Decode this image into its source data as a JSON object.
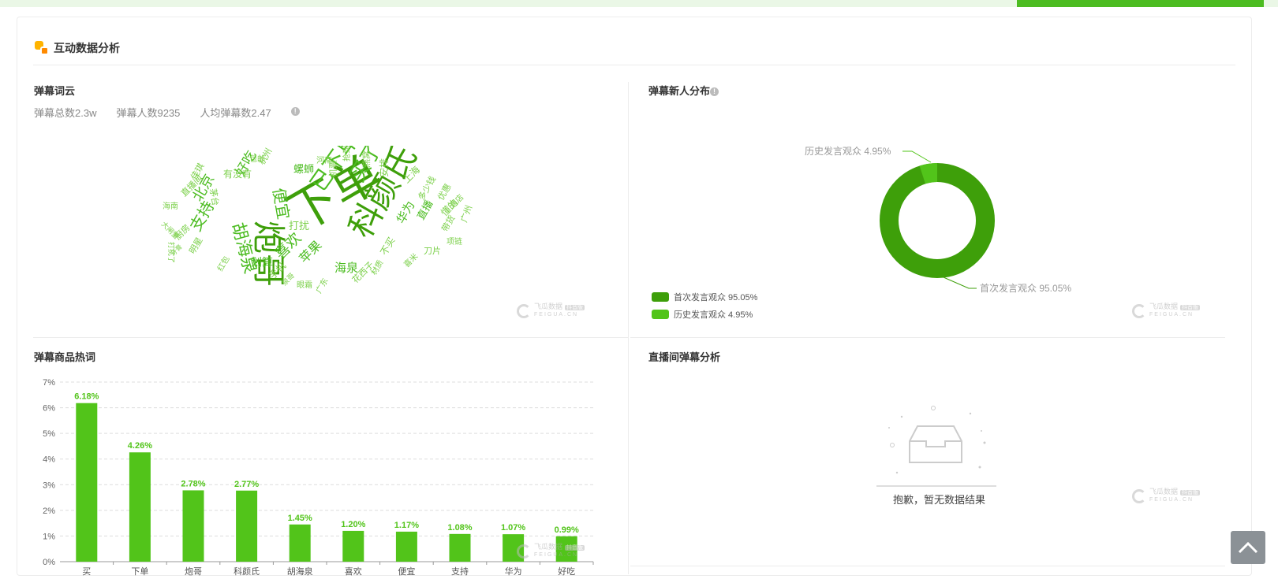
{
  "section": {
    "title": "互动数据分析"
  },
  "danmu_cloud": {
    "title": "弹幕词云",
    "stats": {
      "total": "弹幕总数2.3w",
      "people": "弹幕人数9235",
      "avg": "人均弹幕数2.47"
    },
    "words": [
      "下单",
      "炮哥",
      "科颜氏",
      "已下单",
      "买了",
      "胡海泉",
      "便宜",
      "支持",
      "北京",
      "喜欢",
      "苹果",
      "海泉",
      "划算",
      "华为",
      "好吃",
      "螺蛳",
      "上海",
      "安排",
      "直播",
      "广州",
      "手机",
      "刀片",
      "花西子",
      "不买",
      "懂的",
      "带货",
      "打扰",
      "有没有",
      "直播间",
      "海南",
      "杭州",
      "河南",
      "机票",
      "抢到",
      "燕窝",
      "多少钱",
      "优惠",
      "酒店",
      "项链",
      "喜米",
      "材质",
      "广东",
      "红包",
      "明星",
      "大闸蟹",
      "打扰了",
      "牙膏",
      "厨房",
      "佳琪",
      "泉哥",
      "眼霜",
      "茅台",
      "包邮"
    ]
  },
  "newcomer": {
    "title": "弹幕新人分布",
    "info_glyph": "!",
    "legend": [
      {
        "label": "首次发言观众 95.05%",
        "color": "#3e9f0a"
      },
      {
        "label": "历史发言观众 4.95%",
        "color": "#52c41a"
      }
    ],
    "callouts": {
      "history": "历史发言观众 4.95%",
      "first": "首次发言观众 95.05%"
    }
  },
  "hotwords": {
    "title": "弹幕商品热词",
    "chart_data": {
      "type": "bar",
      "categories": [
        "买",
        "下单",
        "炮哥",
        "科颜氏",
        "胡海泉",
        "喜欢",
        "便宜",
        "支持",
        "华为",
        "好吃"
      ],
      "values": [
        6.18,
        4.26,
        2.78,
        2.77,
        1.45,
        1.2,
        1.17,
        1.08,
        1.07,
        0.99
      ],
      "value_labels": [
        "6.18%",
        "4.26%",
        "2.78%",
        "2.77%",
        "1.45%",
        "1.20%",
        "1.17%",
        "1.08%",
        "1.07%",
        "0.99%"
      ],
      "yticks": [
        "0%",
        "1%",
        "2%",
        "3%",
        "4%",
        "5%",
        "6%",
        "7%"
      ],
      "ylim": [
        0,
        7
      ],
      "grid": true,
      "bar_color": "#52c41a",
      "label_color": "#52c41a"
    }
  },
  "live_analysis": {
    "title": "直播间弹幕分析",
    "empty_text": "抱歉，暂无数据结果"
  },
  "watermark": {
    "text": "飞瓜数据",
    "sub": "FEIGUA.CN",
    "badge": "抖音版"
  },
  "scroll_top": {
    "icon": "chevron-up-icon"
  }
}
